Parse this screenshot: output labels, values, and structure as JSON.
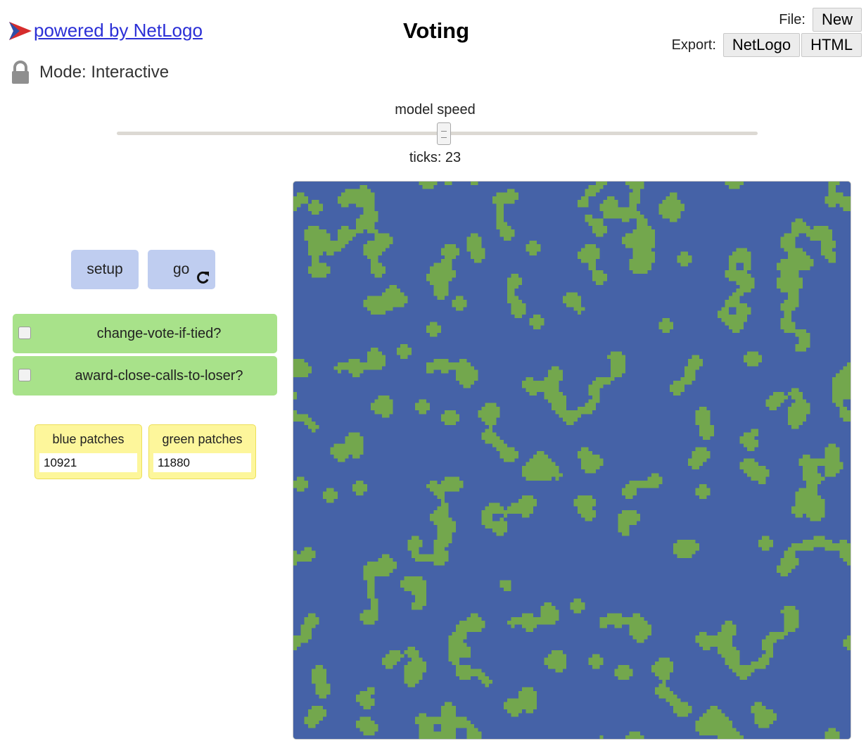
{
  "header": {
    "powered_label": "powered by NetLogo",
    "mode_label": "Mode: Interactive",
    "title": "Voting",
    "file_label": "File:",
    "file_new_label": "New",
    "export_label": "Export:",
    "export_netlogo_label": "NetLogo",
    "export_html_label": "HTML"
  },
  "speed": {
    "label": "model speed",
    "value": 0.5,
    "ticks_label": "ticks: 23"
  },
  "buttons": {
    "setup_label": "setup",
    "go_label": "go"
  },
  "switches": [
    {
      "label": "change-vote-if-tied?",
      "checked": false
    },
    {
      "label": "award-close-calls-to-loser?",
      "checked": false
    }
  ],
  "monitors": [
    {
      "label": "blue patches",
      "value": "10921"
    },
    {
      "label": "green patches",
      "value": "11880"
    }
  ],
  "world": {
    "colors": {
      "blue": "#4562a7",
      "green": "#73a74d"
    },
    "grid_patches": 151
  }
}
